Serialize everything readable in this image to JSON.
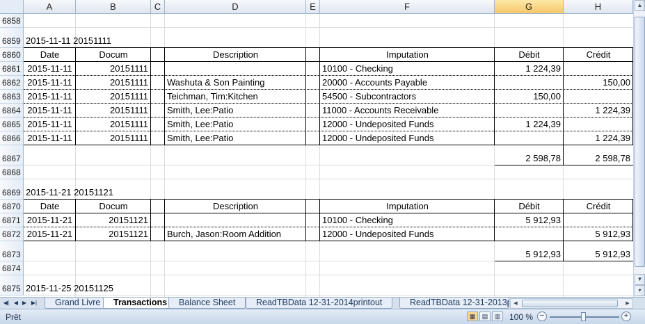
{
  "columns": [
    "A",
    "B",
    "C",
    "D",
    "E",
    "F",
    "G",
    "H"
  ],
  "selected_column": "G",
  "row_numbers": [
    "6858",
    "6859",
    "6860",
    "6861",
    "6862",
    "6863",
    "6864",
    "6865",
    "6866",
    "6867",
    "6868",
    "6869",
    "6870",
    "6871",
    "6872",
    "6873",
    "6874",
    "6875"
  ],
  "section1": {
    "heading": "2015-11-11  20151111",
    "headers": {
      "date": "Date",
      "doc": "Docum",
      "desc": "Description",
      "imp": "Imputation",
      "debit": "Débit",
      "credit": "Crédit"
    },
    "rows": [
      {
        "date": "2015-11-11",
        "doc": "20151111",
        "desc": "",
        "imp": "10100 - Checking",
        "debit": "1 224,39",
        "credit": ""
      },
      {
        "date": "2015-11-11",
        "doc": "20151111",
        "desc": "Washuta & Son Painting",
        "imp": "20000 - Accounts Payable",
        "debit": "",
        "credit": "150,00"
      },
      {
        "date": "2015-11-11",
        "doc": "20151111",
        "desc": "Teichman, Tim:Kitchen",
        "imp": "54500 - Subcontractors",
        "debit": "150,00",
        "credit": ""
      },
      {
        "date": "2015-11-11",
        "doc": "20151111",
        "desc": "Smith, Lee:Patio",
        "imp": "11000 - Accounts Receivable",
        "debit": "",
        "credit": "1 224,39"
      },
      {
        "date": "2015-11-11",
        "doc": "20151111",
        "desc": "Smith, Lee:Patio",
        "imp": "12000 - Undeposited Funds",
        "debit": "1 224,39",
        "credit": ""
      },
      {
        "date": "2015-11-11",
        "doc": "20151111",
        "desc": "Smith, Lee:Patio",
        "imp": "12000 - Undeposited Funds",
        "debit": "",
        "credit": "1 224,39"
      }
    ],
    "total_debit": "2 598,78",
    "total_credit": "2 598,78"
  },
  "section2": {
    "heading": "2015-11-21  20151121",
    "headers": {
      "date": "Date",
      "doc": "Docum",
      "desc": "Description",
      "imp": "Imputation",
      "debit": "Débit",
      "credit": "Crédit"
    },
    "rows": [
      {
        "date": "2015-11-21",
        "doc": "20151121",
        "desc": "",
        "imp": "10100 - Checking",
        "debit": "5 912,93",
        "credit": ""
      },
      {
        "date": "2015-11-21",
        "doc": "20151121",
        "desc": "Burch, Jason:Room Addition",
        "imp": "12000 - Undeposited Funds",
        "debit": "",
        "credit": "5 912,93"
      }
    ],
    "total_debit": "5 912,93",
    "total_credit": "5 912,93"
  },
  "section3": {
    "heading": "2015-11-25  20151125"
  },
  "tabs": [
    "Grand Livre",
    "Transactions",
    "Balance Sheet",
    "ReadTBData 12-31-2014printout",
    "ReadTBData 12-31-2013p"
  ],
  "active_tab": "Transactions",
  "status": {
    "mode": "Prêt",
    "zoom": "100 %"
  }
}
